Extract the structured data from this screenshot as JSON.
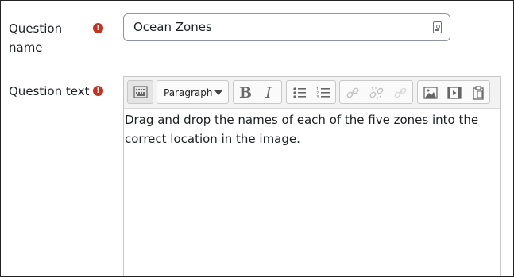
{
  "form": {
    "question_name": {
      "label_line1": "Question",
      "label_line2": "name",
      "required_glyph": "!",
      "value": "Ocean Zones"
    },
    "question_text": {
      "label": "Question text",
      "required_glyph": "!",
      "format_select": "Paragraph",
      "content": "Drag and drop the names of each of the five zones into the correct location in the image."
    }
  },
  "toolbar": {
    "bold_glyph": "B",
    "italic_glyph": "I",
    "icons": [
      "keyboard-icon",
      "bold-icon",
      "italic-icon",
      "unordered-list-icon",
      "ordered-list-icon",
      "link-icon",
      "unlink-icon",
      "anchor-link-icon",
      "image-icon",
      "video-icon",
      "paste-icon"
    ]
  },
  "colors": {
    "required": "#ca3120",
    "border": "#8f959e",
    "toolbar_bg": "#f2f2f2"
  }
}
